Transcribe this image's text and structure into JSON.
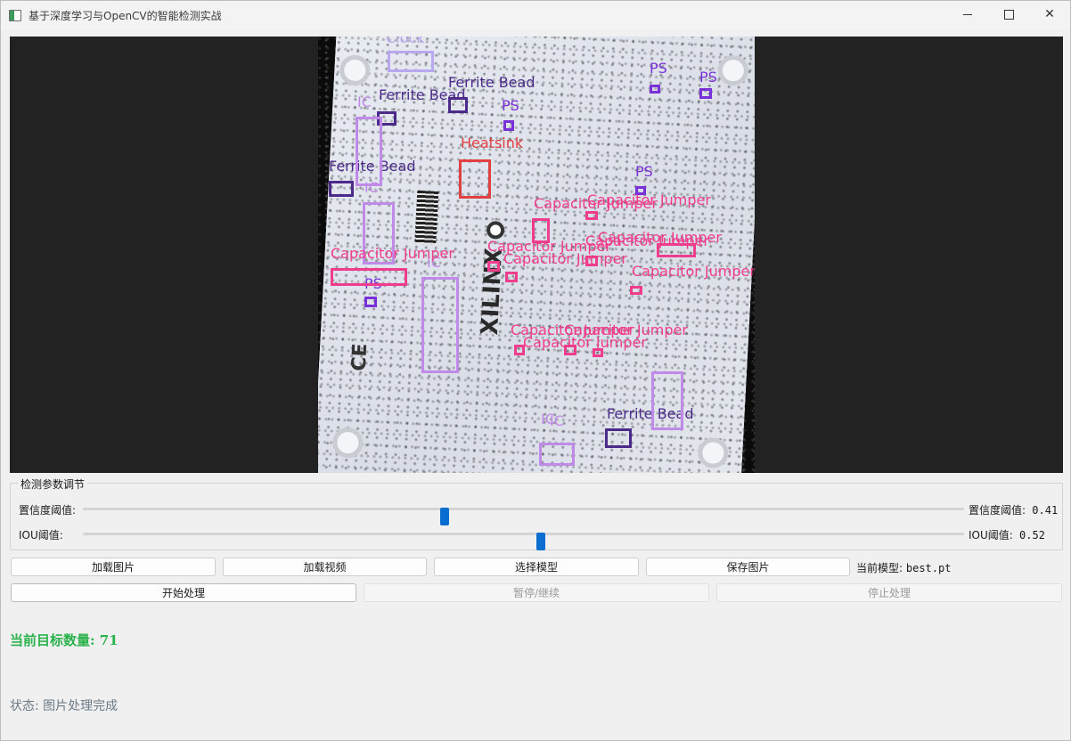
{
  "window": {
    "title": "基于深度学习与OpenCV的智能检测实战",
    "controls": {
      "minimize": "",
      "maximize": "",
      "close": "✕"
    }
  },
  "image": {
    "board_text": "XILINX",
    "ce_mark": "CE",
    "detections": [
      {
        "label": "Clock",
        "color": "#b9a8f0"
      },
      {
        "label": "Ferrite Bead",
        "color": "#4b2a8a"
      },
      {
        "label": "Ferrite Bead",
        "color": "#4b2a8a"
      },
      {
        "label": "Ferrite Bead",
        "color": "#4b2a8a"
      },
      {
        "label": "Ferrite Bead",
        "color": "#4b2a8a"
      },
      {
        "label": "Heatsink",
        "color": "#e04040"
      },
      {
        "label": "IC",
        "color": "#c08ae8"
      },
      {
        "label": "IC",
        "color": "#c08ae8"
      },
      {
        "label": "IC",
        "color": "#c08ae8"
      },
      {
        "label": "IC",
        "color": "#c08ae8"
      },
      {
        "label": "IC",
        "color": "#c08ae8"
      },
      {
        "label": "PS",
        "color": "#7a30d8"
      },
      {
        "label": "PS",
        "color": "#7a30d8"
      },
      {
        "label": "PS",
        "color": "#7a30d8"
      },
      {
        "label": "PS",
        "color": "#7a30d8"
      },
      {
        "label": "PS",
        "color": "#7a30d8"
      },
      {
        "label": "Capacitor Jumper",
        "color": "#f03c8c"
      },
      {
        "label": "Capacitor Jumper",
        "color": "#f03c8c"
      },
      {
        "label": "Capacitor Jumper",
        "color": "#f03c8c"
      },
      {
        "label": "Capacitor Jumper",
        "color": "#f03c8c"
      },
      {
        "label": "Capacitor Jumper",
        "color": "#f03c8c"
      },
      {
        "label": "Capacitor Jumper",
        "color": "#f03c8c"
      },
      {
        "label": "Capacitor Jumper",
        "color": "#f03c8c"
      },
      {
        "label": "Capacitor Jumper",
        "color": "#f03c8c"
      },
      {
        "label": "Capacitor Jumper",
        "color": "#f03c8c"
      },
      {
        "label": "Capacitor Jumper",
        "color": "#f03c8c"
      },
      {
        "label": "Capacitor Jumper",
        "color": "#f03c8c"
      },
      {
        "label": "Clock",
        "color": "#b9a8f0"
      }
    ]
  },
  "params": {
    "group_title": "检测参数调节",
    "confidence": {
      "label": "置信度阈值:",
      "value_label": "置信度阈值:",
      "value": "0.41",
      "fraction": 0.41
    },
    "iou": {
      "label": "IOU阈值:",
      "value_label": "IOU阈值:",
      "value": "0.52",
      "fraction": 0.52
    }
  },
  "buttons": {
    "load_image": "加载图片",
    "load_video": "加载视频",
    "select_model": "选择模型",
    "save_image": "保存图片",
    "start": "开始处理",
    "pause": "暂停/继续",
    "stop": "停止处理"
  },
  "model": {
    "label": "当前模型:",
    "name": "best.pt"
  },
  "count": {
    "text": "当前目标数量: 71"
  },
  "status": {
    "text": "状态: 图片处理完成"
  }
}
